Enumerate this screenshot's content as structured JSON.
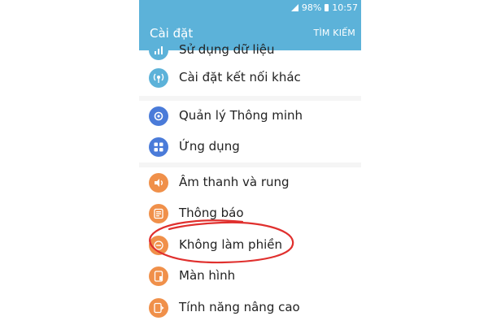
{
  "status_bar": {
    "battery": "98%",
    "time": "10:57"
  },
  "app_bar": {
    "title": "Cài đặt",
    "search_action": "TÌM KIẾM",
    "color": "#5cb2d9"
  },
  "settings_groups": [
    {
      "items": [
        {
          "label": "Sử dụng dữ liệu",
          "icon": "data-usage-icon",
          "color": "#5cb2d9"
        },
        {
          "label": "Cài đặt kết nối khác",
          "icon": "connection-settings-icon",
          "color": "#5cb2d9"
        }
      ]
    },
    {
      "items": [
        {
          "label": "Quản lý Thông minh",
          "icon": "smart-manager-icon",
          "color": "#4a7bd9"
        },
        {
          "label": "Ứng dụng",
          "icon": "apps-grid-icon",
          "color": "#4a7bd9"
        }
      ]
    },
    {
      "items": [
        {
          "label": "Âm thanh và rung",
          "icon": "speaker-icon",
          "color": "#f0904a"
        },
        {
          "label": "Thông báo",
          "icon": "notification-icon",
          "color": "#f0904a"
        },
        {
          "label": "Không làm phiền",
          "icon": "do-not-disturb-icon",
          "color": "#f0904a"
        },
        {
          "label": "Màn hình",
          "icon": "display-icon",
          "color": "#f0904a"
        },
        {
          "label": "Tính năng nâng cao",
          "icon": "advanced-features-icon",
          "color": "#f0904a"
        }
      ]
    }
  ],
  "annotation": {
    "highlighted_item": "Không làm phiền",
    "color": "#e0302e"
  }
}
